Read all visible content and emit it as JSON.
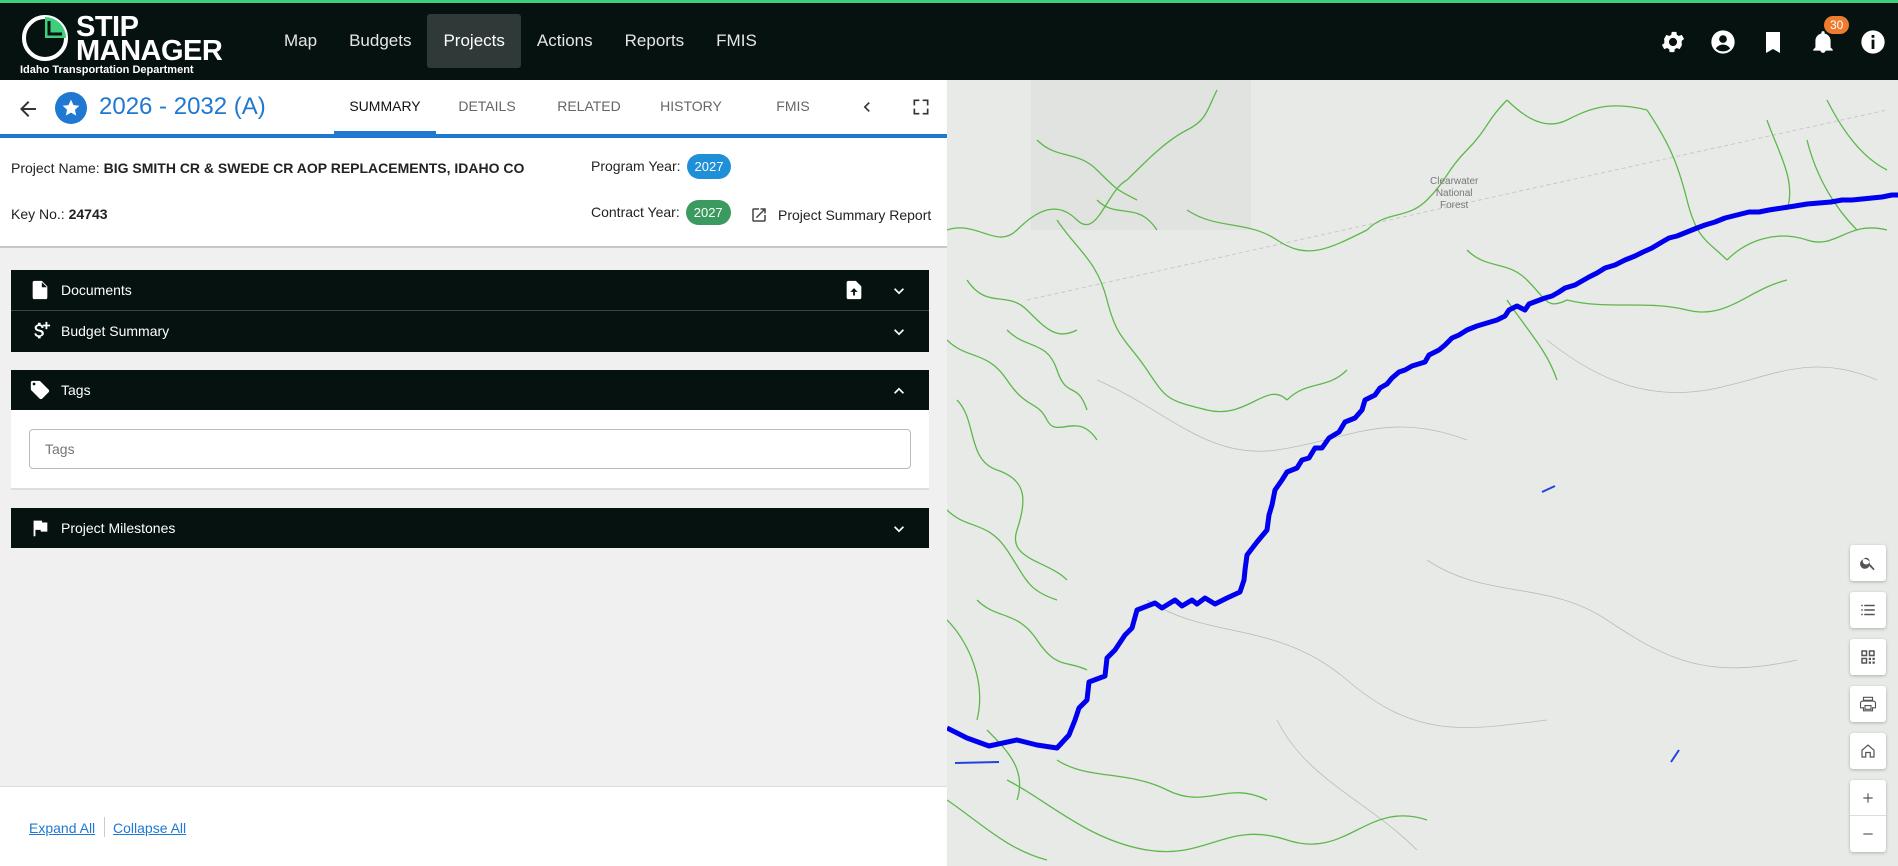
{
  "app": {
    "logo_line1": "STIP",
    "logo_line2": "MANAGER",
    "logo_sub": "Idaho Transportation Department"
  },
  "nav": {
    "items": [
      "Map",
      "Budgets",
      "Projects",
      "Actions",
      "Reports",
      "FMIS"
    ],
    "active": "Projects"
  },
  "notifications": {
    "count": "30"
  },
  "project": {
    "title": "2026 - 2032 (A)",
    "tabs": [
      "SUMMARY",
      "DETAILS",
      "RELATED",
      "HISTORY",
      "FMIS"
    ],
    "active_tab": "SUMMARY",
    "name_label": "Project Name:",
    "name": "BIG SMITH CR & SWEDE CR AOP REPLACEMENTS, IDAHO CO",
    "key_label": "Key No.:",
    "key": "24743",
    "program_year_label": "Program Year:",
    "program_year": "2027",
    "contract_year_label": "Contract Year:",
    "contract_year": "2027",
    "summary_report": "Project Summary Report"
  },
  "panels": {
    "documents": "Documents",
    "budget": "Budget Summary",
    "tags": "Tags",
    "milestones": "Project Milestones"
  },
  "tags_input": {
    "placeholder": "Tags"
  },
  "footer": {
    "expand": "Expand All",
    "collapse": "Collapse All"
  },
  "map": {
    "label_line1": "Clearwater",
    "label_line2": "National",
    "label_line3": "Forest"
  },
  "colors": {
    "accent": "#1f78d1",
    "topbar": "#061210",
    "route": "#0000ee",
    "rivers": "#5db84a",
    "badge": "#ef7b2f"
  }
}
